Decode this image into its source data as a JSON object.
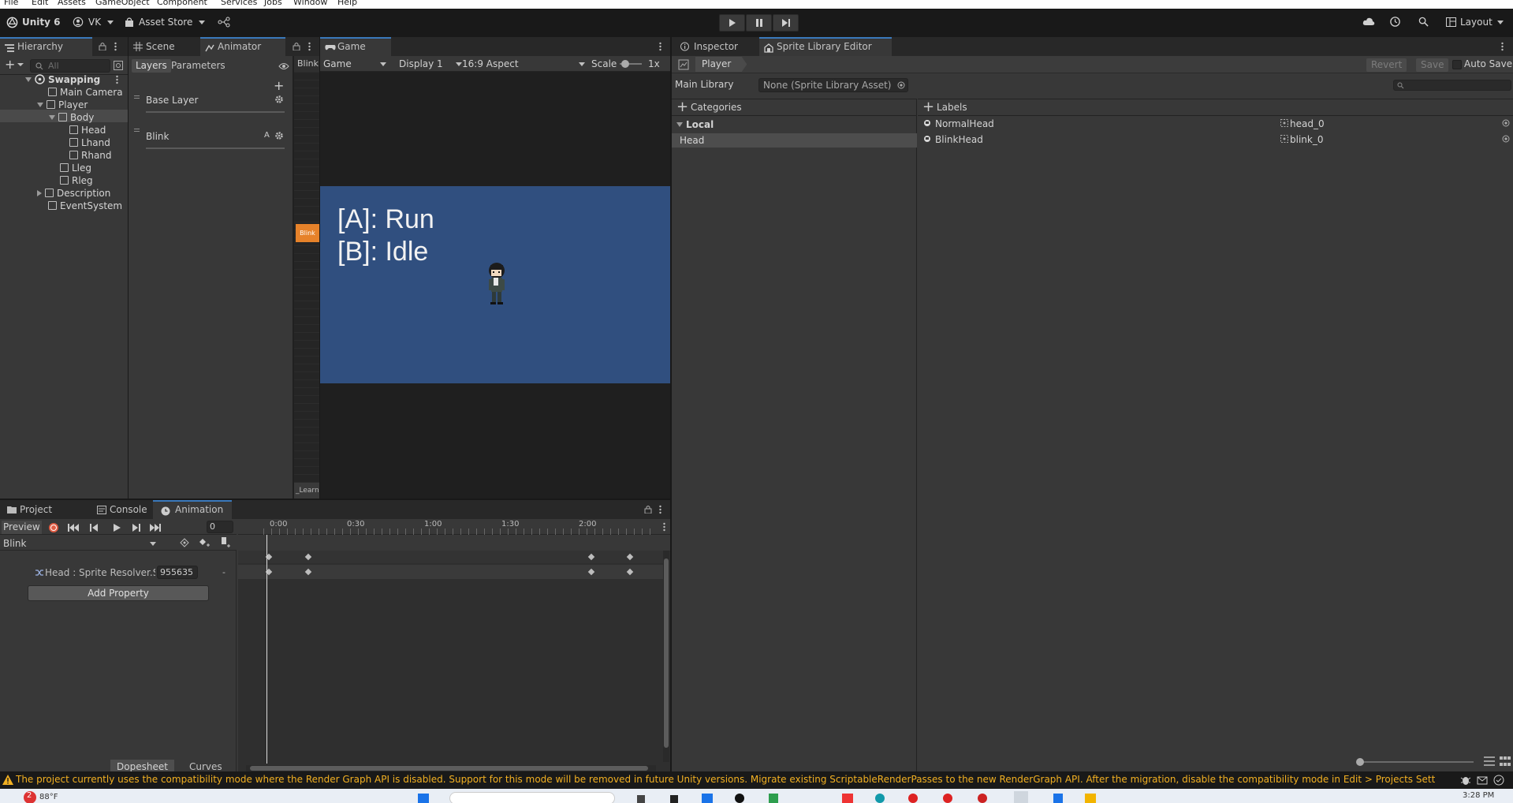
{
  "menu": [
    "File",
    "Edit",
    "Assets",
    "GameObject",
    "Component",
    "Services",
    "Jobs",
    "Window",
    "Help"
  ],
  "toolbar": {
    "product": "Unity 6",
    "account": "VK",
    "asset_store": "Asset Store",
    "layout": "Layout"
  },
  "hierarchy": {
    "tab": "Hierarchy",
    "search_placeholder": "All",
    "items": [
      {
        "label": "Swapping",
        "depth": 0
      },
      {
        "label": "Main Camera",
        "depth": 1
      },
      {
        "label": "Player",
        "depth": 1
      },
      {
        "label": "Body",
        "depth": 2
      },
      {
        "label": "Head",
        "depth": 3,
        "selected": true
      },
      {
        "label": "Lhand",
        "depth": 3
      },
      {
        "label": "Rhand",
        "depth": 3
      },
      {
        "label": "Lleg",
        "depth": 2
      },
      {
        "label": "Rleg",
        "depth": 2
      },
      {
        "label": "Description",
        "depth": 1
      },
      {
        "label": "EventSystem",
        "depth": 1
      }
    ]
  },
  "animator": {
    "tabs": [
      "Scene",
      "Animator"
    ],
    "layers_tab": "Layers",
    "parameters_tab": "Parameters",
    "layers": [
      {
        "name": "Base Layer",
        "badge": ""
      },
      {
        "name": "Blink",
        "badge": "A"
      }
    ],
    "graph_label": "Blink",
    "state_label": "Blink",
    "footer_label": "_Learn"
  },
  "game": {
    "tab": "Game",
    "mode": "Game",
    "display": "Display 1",
    "aspect": "16:9 Aspect",
    "scale_label": "Scale",
    "scale_value": "1x",
    "text_line1": "[A]: Run",
    "text_line2": "[B]: Idle",
    "bg_color": "#304f7f"
  },
  "inspector": {
    "tabs": [
      "Inspector",
      "Sprite Library Editor"
    ],
    "object": "Player",
    "revert": "Revert",
    "save": "Save",
    "auto_save": "Auto Save",
    "main_library_label": "Main Library",
    "main_library_value": "None (Sprite Library Asset)",
    "categories_header": "Categories",
    "local_group": "Local",
    "categories": [
      "Head"
    ],
    "labels_header": "Labels",
    "labels": [
      {
        "name": "NormalHead",
        "sprite": "head_0"
      },
      {
        "name": "BlinkHead",
        "sprite": "blink_0"
      }
    ]
  },
  "bottom": {
    "tabs": [
      "Project",
      "Console",
      "Animation"
    ],
    "preview": "Preview",
    "frame": "0",
    "clip": "Blink",
    "property": "Head : Sprite Resolver.S",
    "property_value": "955635",
    "add_property": "Add Property",
    "timeline_ticks": [
      "0:00",
      "0:30",
      "1:00",
      "1:30",
      "2:00"
    ],
    "dopesheet": "Dopesheet",
    "curves": "Curves"
  },
  "status": {
    "message": "The project currently uses the compatibility mode where the Render Graph API is disabled. Support for this mode will be removed in future Unity versions. Migrate existing ScriptableRenderPasses to the new RenderGraph API. After the migration, disable the compatibility mode in Edit > Projects Settings > Graphics > R",
    "warning_color": "#f2b022"
  },
  "taskbar": {
    "weather": "88°F",
    "badge": "2",
    "time": "3:28 PM"
  }
}
